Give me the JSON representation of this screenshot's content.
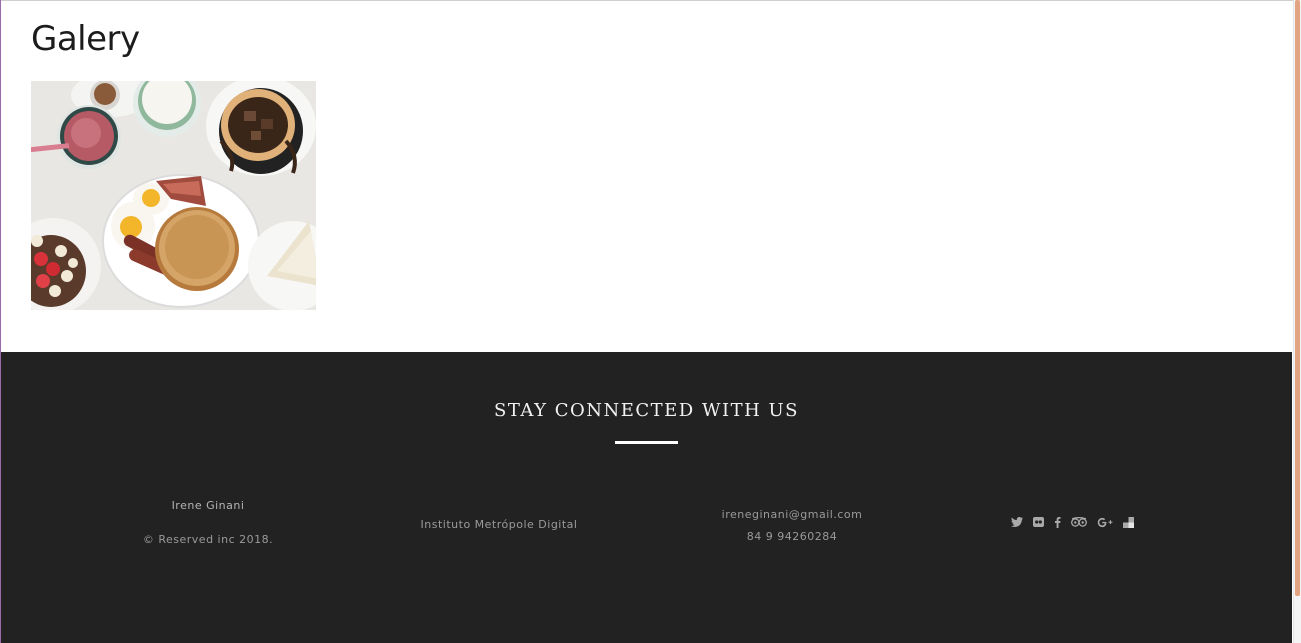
{
  "gallery": {
    "title": "Galery"
  },
  "footer": {
    "heading": "STAY CONNECTED WITH US",
    "name": "Irene Ginani",
    "copyright": "© Reserved inc 2018.",
    "institute": "Instituto Metrópole Digital",
    "email": "ireneginani@gmail.com",
    "phone": "84 9 94260284",
    "social": [
      "twitter-icon",
      "flickr-icon",
      "facebook-icon",
      "tripadvisor-icon",
      "google-plus-icon",
      "delicious-icon"
    ]
  },
  "colors": {
    "footer_bg": "#222222",
    "footer_text": "#9a9a9a",
    "scrollbar_thumb": "#e2a483"
  }
}
